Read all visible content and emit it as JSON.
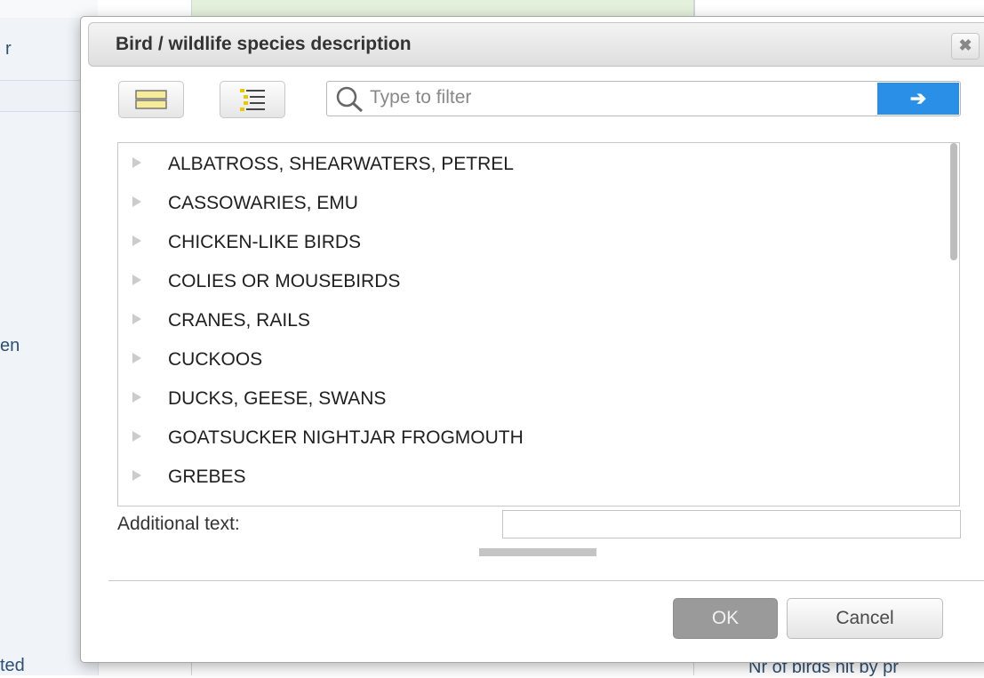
{
  "background": {
    "fragments": [
      {
        "name": "bg-fragment-r",
        "text": "r"
      },
      {
        "name": "bg-fragment-en",
        "text": "en"
      },
      {
        "name": "bg-fragment-ted",
        "text": "ted"
      },
      {
        "name": "bg-fragment-birds-hit",
        "text": "Nr of birds hit by pr"
      }
    ]
  },
  "dialog": {
    "title": "Bird / wildlife species description",
    "close_icon": "close-icon",
    "toolbar": {
      "flat_view_icon": "flat-list-icon",
      "tree_view_icon": "tree-list-icon"
    },
    "search": {
      "placeholder": "Type to filter",
      "value": "",
      "go_label": "➔"
    },
    "tree_items": [
      "ALBATROSS, SHEARWATERS, PETREL",
      "CASSOWARIES, EMU",
      "CHICKEN-LIKE BIRDS",
      "COLIES OR MOUSEBIRDS",
      "CRANES, RAILS",
      "CUCKOOS",
      "DUCKS, GEESE, SWANS",
      "GOATSUCKER NIGHTJAR FROGMOUTH",
      "GREBES"
    ],
    "additional_text": {
      "label": "Additional text:",
      "value": ""
    },
    "buttons": {
      "ok": "OK",
      "cancel": "Cancel"
    }
  },
  "colors": {
    "accent": "#2a8fe6",
    "background_text": "#2e4f70"
  }
}
